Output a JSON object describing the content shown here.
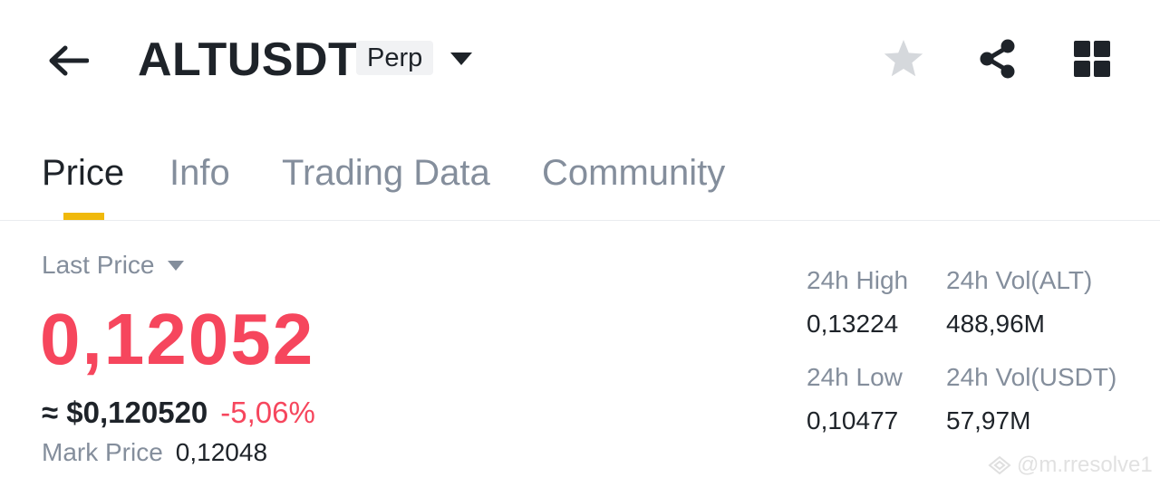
{
  "header": {
    "symbol": "ALTUSDT",
    "contract_type": "Perp",
    "icons": {
      "back": "arrow-left-icon",
      "dropdown": "caret-down-icon",
      "favorite": "star-icon",
      "share": "share-icon",
      "menu": "grid-icon"
    }
  },
  "tabs": [
    {
      "label": "Price",
      "active": true
    },
    {
      "label": "Info",
      "active": false
    },
    {
      "label": "Trading Data",
      "active": false
    },
    {
      "label": "Community",
      "active": false
    }
  ],
  "price": {
    "last_price_label": "Last Price",
    "last_price": "0,12052",
    "usd_value": "≈ $0,120520",
    "change_pct": "-5,06%",
    "mark_price_label": "Mark Price",
    "mark_price": "0,12048"
  },
  "stats": {
    "high_label": "24h High",
    "high_value": "0,13224",
    "vol_base_label": "24h Vol(ALT)",
    "vol_base_value": "488,96M",
    "low_label": "24h Low",
    "low_value": "0,10477",
    "vol_quote_label": "24h Vol(USDT)",
    "vol_quote_value": "57,97M"
  },
  "watermark": "@m.rresolve1",
  "colors": {
    "text_primary": "#1e2329",
    "text_secondary": "#848e9c",
    "negative": "#f6465d",
    "accent": "#f0b90b",
    "star_inactive": "#d5d8dc"
  }
}
